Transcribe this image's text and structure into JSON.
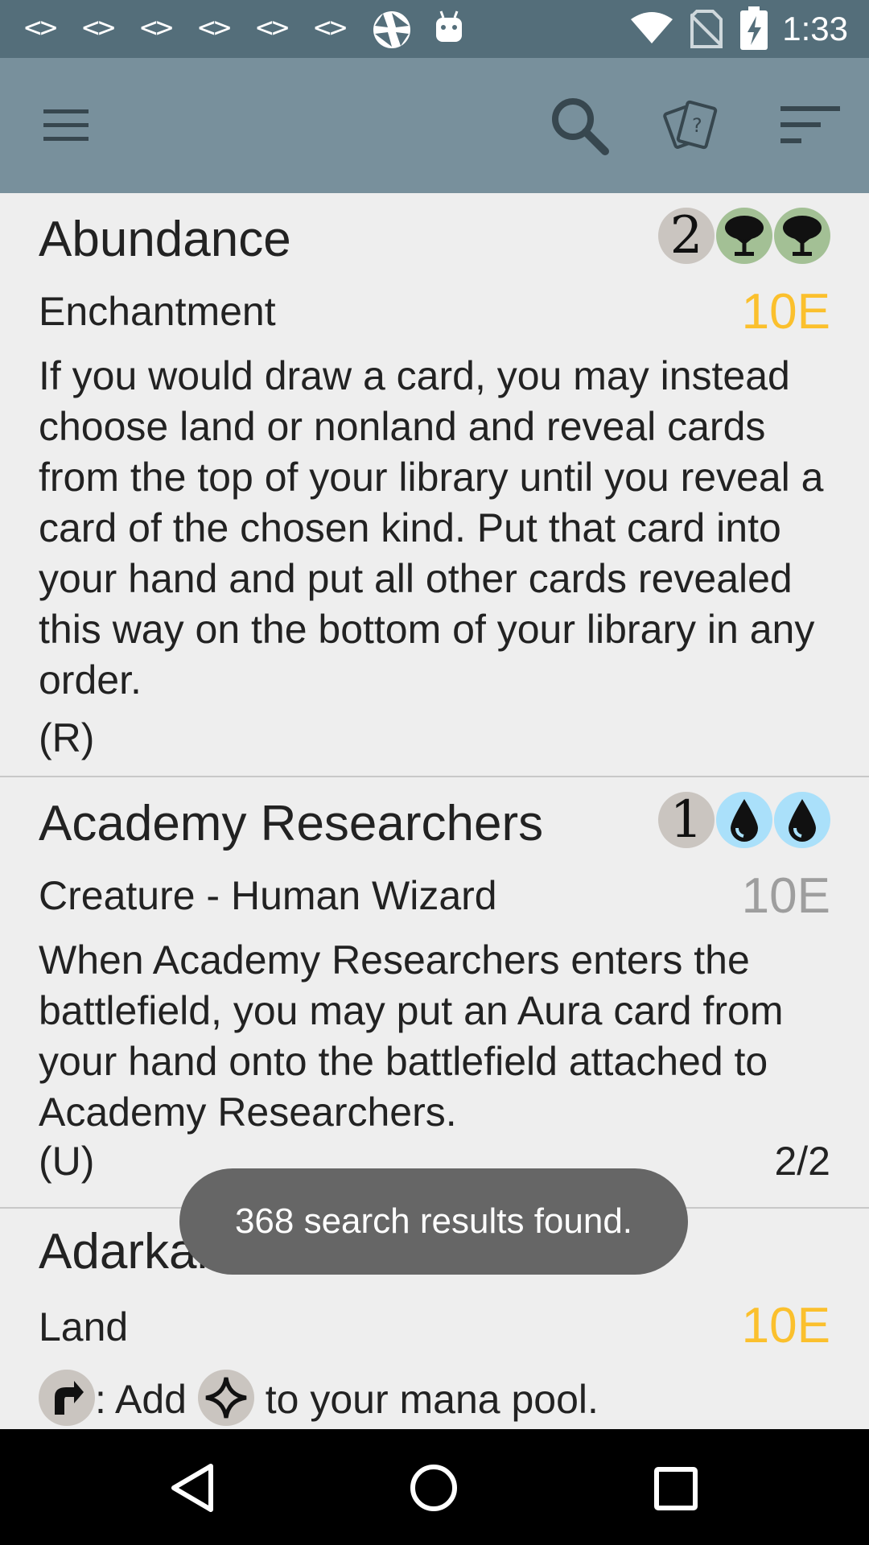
{
  "status_bar": {
    "notification_codes": [
      "<>",
      "<>",
      "<>",
      "<>",
      "<>",
      "<>"
    ],
    "time": "1:33",
    "icons": [
      "aperture-icon",
      "android-icon",
      "wifi-icon",
      "no-sim-icon",
      "battery-charging-icon"
    ]
  },
  "toolbar": {
    "icons": [
      "menu-icon",
      "search-icon",
      "cards-help-icon",
      "sort-icon"
    ]
  },
  "cards": [
    {
      "name": "Abundance",
      "mana": [
        "2",
        "G",
        "G"
      ],
      "type": "Enchantment",
      "set": "10E",
      "set_color": "#fbc02d",
      "text": "If you would draw a card, you may instead choose land or nonland and reveal cards from the top of your library until you reveal a card of the chosen kind. Put that card into your hand and put all other cards revealed this way on the bottom of your library in any order.",
      "rarity": "(R)"
    },
    {
      "name": "Academy Researchers",
      "mana": [
        "1",
        "U",
        "U"
      ],
      "type": "Creature - Human Wizard",
      "set": "10E",
      "set_color": "#9e9e9e",
      "text": "When Academy Researchers enters the battlefield, you may put an Aura card from your hand onto the battlefield attached to Academy Researchers.",
      "rarity": "(U)",
      "pt": "2/2"
    },
    {
      "name": "Adarkar Wastes",
      "type": "Land",
      "set": "10E",
      "set_color": "#fbc02d",
      "text_part1": ": Add ",
      "text_part2": " to your mana pool."
    }
  ],
  "toast": {
    "message": "368 search results found."
  },
  "colors": {
    "status_bar": "#546e7a",
    "toolbar": "#78909c",
    "background": "#eeeeee",
    "toast": "#666666",
    "rare_set": "#fbc02d",
    "uncommon_set": "#9e9e9e"
  },
  "navbar": {
    "icons": [
      "back-icon",
      "home-icon",
      "recents-icon"
    ]
  }
}
